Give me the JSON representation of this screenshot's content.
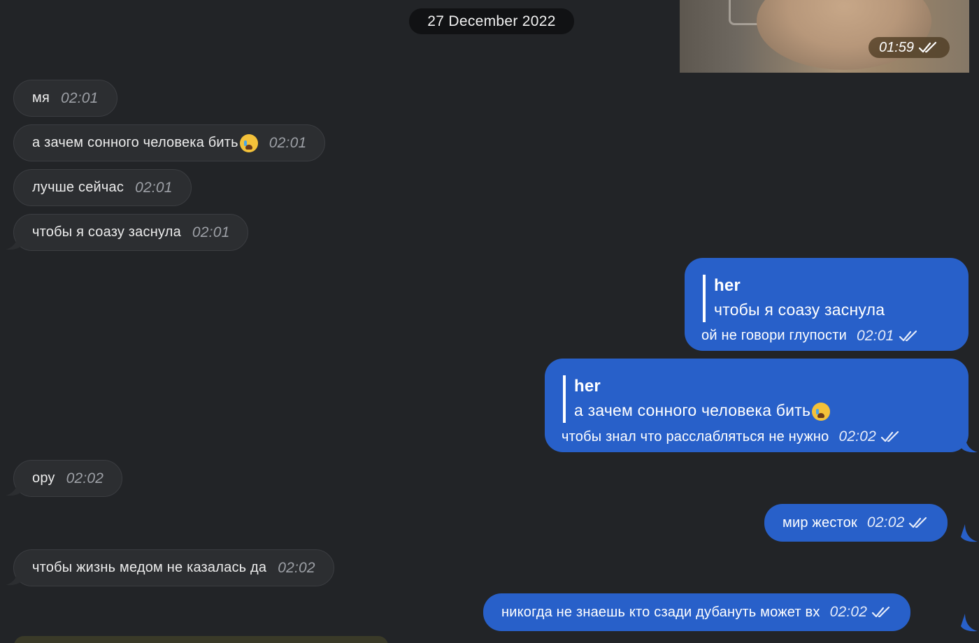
{
  "date_chip": "27 December 2022",
  "photo_message": {
    "time": "01:59"
  },
  "messages": [
    {
      "text": "мя",
      "time": "02:01"
    },
    {
      "text": "а зачем сонного человека бить",
      "emoji": "crying-face-icon",
      "time": "02:01"
    },
    {
      "text": "лучше сейчас",
      "time": "02:01"
    },
    {
      "text": "чтобы я соазу заснула",
      "time": "02:01"
    },
    {
      "reply_author": "her",
      "reply_text": "чтобы я соазу заснула",
      "text": "ой не говори глупости",
      "time": "02:01"
    },
    {
      "reply_author": "her",
      "reply_text": "а зачем сонного человека бить",
      "text": "чтобы знал что расслабляться не нужно",
      "time": "02:02"
    },
    {
      "text": "ору",
      "time": "02:02"
    },
    {
      "text": "мир жесток",
      "time": "02:02"
    },
    {
      "text": "чтобы жизнь медом не казалась да",
      "time": "02:02"
    },
    {
      "text": "никогда не знаешь кто сзади дубануть может вх",
      "time": "02:02"
    }
  ],
  "colors": {
    "background": "#222427",
    "incoming_bubble": "#2c2e31",
    "outgoing_bubble": "#2860c9",
    "date_chip": "#111214"
  },
  "icons": [
    "double-check-icon",
    "crying-face-icon"
  ]
}
